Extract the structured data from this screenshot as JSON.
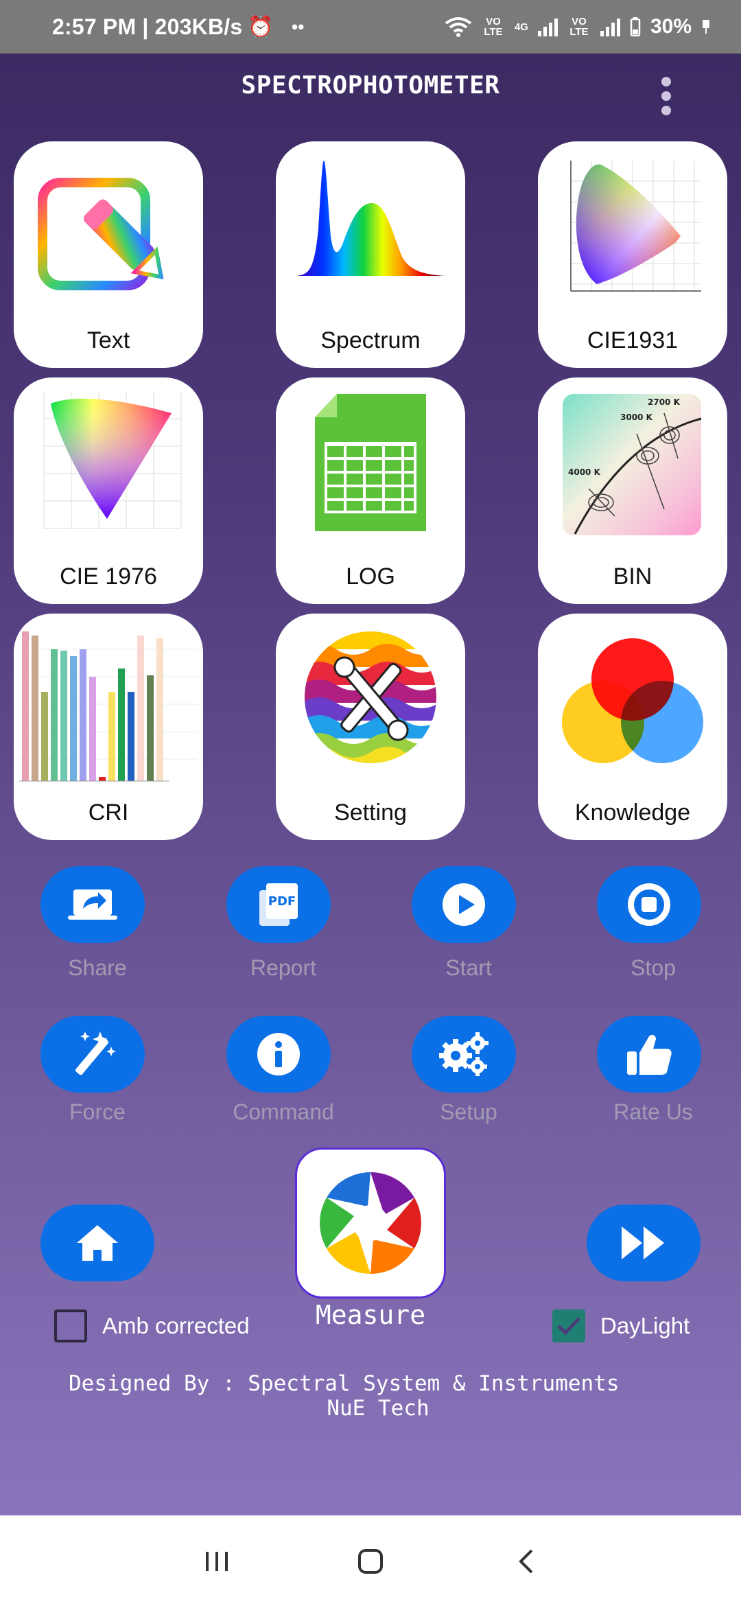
{
  "status_bar": {
    "time_speed": "2:57 PM | 203KB/s",
    "alarm_icon": "alarm-clock-icon",
    "dots": "••",
    "wifi_icon": "wifi-icon",
    "volte1": "VO LTE",
    "net": "4G",
    "volte2": "VO LTE",
    "battery": "30%"
  },
  "app": {
    "title": "SPECTROPHOTOMETER",
    "menu_icon": "more-vert-icon"
  },
  "tiles": [
    {
      "label": "Text",
      "icon": "edit-pencil-icon"
    },
    {
      "label": "Spectrum",
      "icon": "spectrum-chart-icon"
    },
    {
      "label": "CIE1931",
      "icon": "cie1931-diagram-icon"
    },
    {
      "label": "CIE 1976",
      "icon": "cie1976-diagram-icon"
    },
    {
      "label": "LOG",
      "icon": "spreadsheet-icon"
    },
    {
      "label": "BIN",
      "icon": "binning-chart-icon"
    },
    {
      "label": "CRI",
      "icon": "cri-bar-chart-icon"
    },
    {
      "label": "Setting",
      "icon": "tools-icon"
    },
    {
      "label": "Knowledge",
      "icon": "color-venn-icon"
    }
  ],
  "actions": [
    {
      "label": "Share",
      "icon": "share-screen-icon"
    },
    {
      "label": "Report",
      "icon": "pdf-icon"
    },
    {
      "label": "Start",
      "icon": "play-icon"
    },
    {
      "label": "Stop",
      "icon": "stop-icon"
    },
    {
      "label": "Force",
      "icon": "magic-wand-icon"
    },
    {
      "label": "Command",
      "icon": "info-icon"
    },
    {
      "label": "Setup",
      "icon": "gears-icon"
    },
    {
      "label": "Rate Us",
      "icon": "thumbs-up-icon"
    }
  ],
  "bottom": {
    "home_icon": "home-icon",
    "forward_icon": "fast-forward-icon",
    "measure_label": "Measure",
    "measure_icon": "aperture-icon",
    "amb_label": "Amb corrected",
    "amb_checked": false,
    "daylight_label": "DayLight",
    "daylight_checked": true
  },
  "footer": {
    "line1": "Designed By : Spectral System & Instruments",
    "line2": "NuE Tech"
  },
  "nav": {
    "recents_icon": "recents-icon",
    "home_icon": "nav-home-icon",
    "back_icon": "back-icon"
  },
  "colors": {
    "action_blue": "#0b6fe6",
    "checkbox_teal": "#1e7f72",
    "bg_top": "#3c2a63",
    "bg_bottom": "#8a75bc"
  }
}
